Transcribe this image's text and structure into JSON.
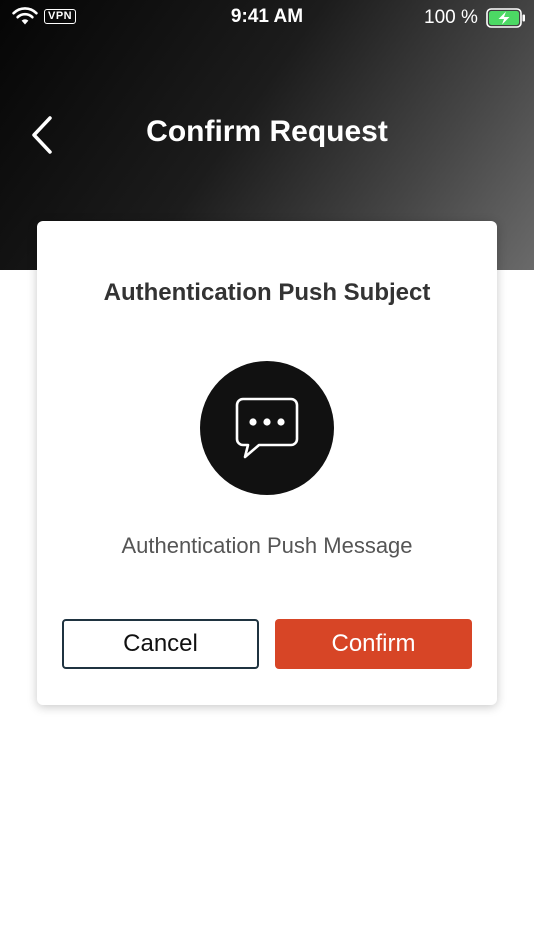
{
  "status_bar": {
    "vpn_label": "VPN",
    "time": "9:41 AM",
    "battery_percent": "100 %",
    "battery_level": 1.0,
    "battery_color": "#4cd964"
  },
  "nav": {
    "title": "Confirm Request",
    "back_icon": "chevron-left-icon"
  },
  "card": {
    "subject": "Authentication Push Subject",
    "icon": "message-bubble-icon",
    "message": "Authentication Push Message",
    "cancel_label": "Cancel",
    "confirm_label": "Confirm"
  },
  "colors": {
    "accent": "#d74526",
    "cancel_border": "#1f3340",
    "icon_background": "#111111"
  }
}
